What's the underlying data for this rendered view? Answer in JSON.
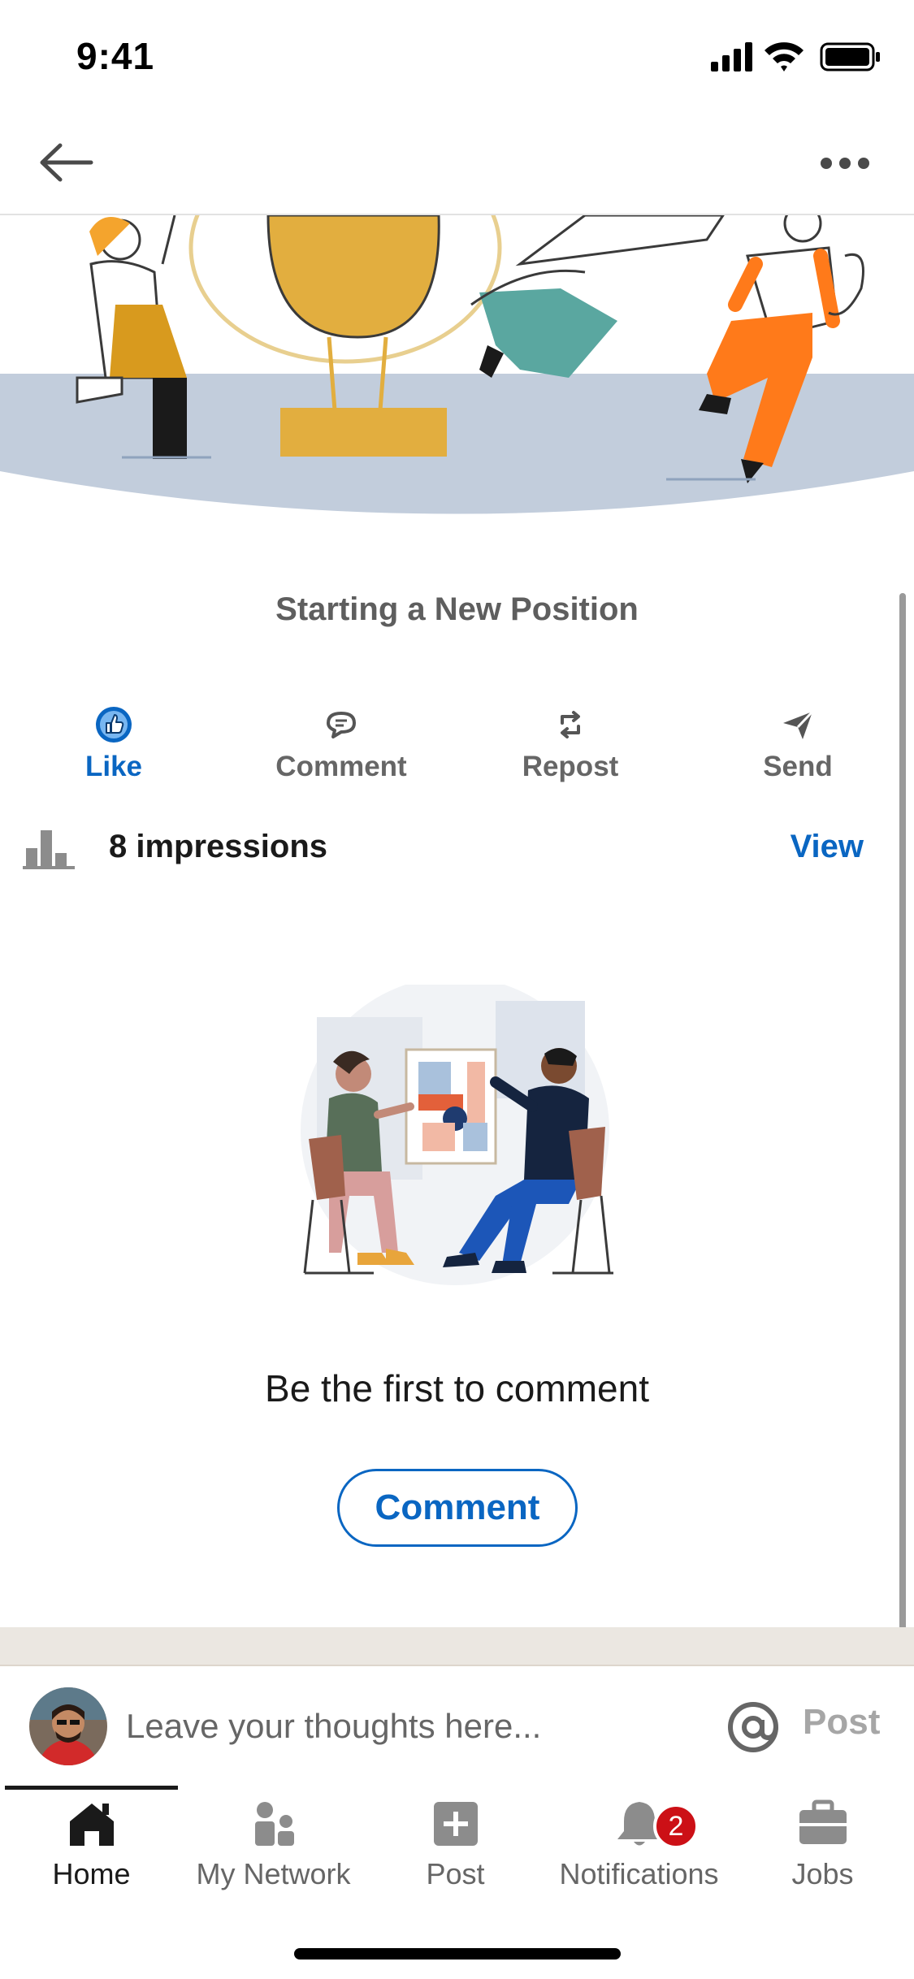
{
  "status_bar": {
    "time": "9:41"
  },
  "post": {
    "title": "Starting a New Position",
    "actions": [
      {
        "id": "like",
        "label": "Like",
        "icon": "like-icon",
        "active": true
      },
      {
        "id": "comment",
        "label": "Comment",
        "icon": "comment-icon"
      },
      {
        "id": "repost",
        "label": "Repost",
        "icon": "repost-icon"
      },
      {
        "id": "send",
        "label": "Send",
        "icon": "send-icon"
      }
    ],
    "impressions": {
      "text": "8 impressions",
      "view_label": "View"
    }
  },
  "comments": {
    "empty_text": "Be the first to comment",
    "comment_button_label": "Comment"
  },
  "composer": {
    "placeholder": "Leave your thoughts here...",
    "post_label": "Post"
  },
  "tabs": [
    {
      "label": "Home",
      "icon": "home-icon",
      "active": true
    },
    {
      "label": "My Network",
      "icon": "network-icon"
    },
    {
      "label": "Post",
      "icon": "post-icon"
    },
    {
      "label": "Notifications",
      "icon": "bell-icon",
      "badge": "2"
    },
    {
      "label": "Jobs",
      "icon": "briefcase-icon"
    }
  ],
  "colors": {
    "accent": "#0a66c2",
    "badge": "#cc1016",
    "muted": "#666666"
  }
}
